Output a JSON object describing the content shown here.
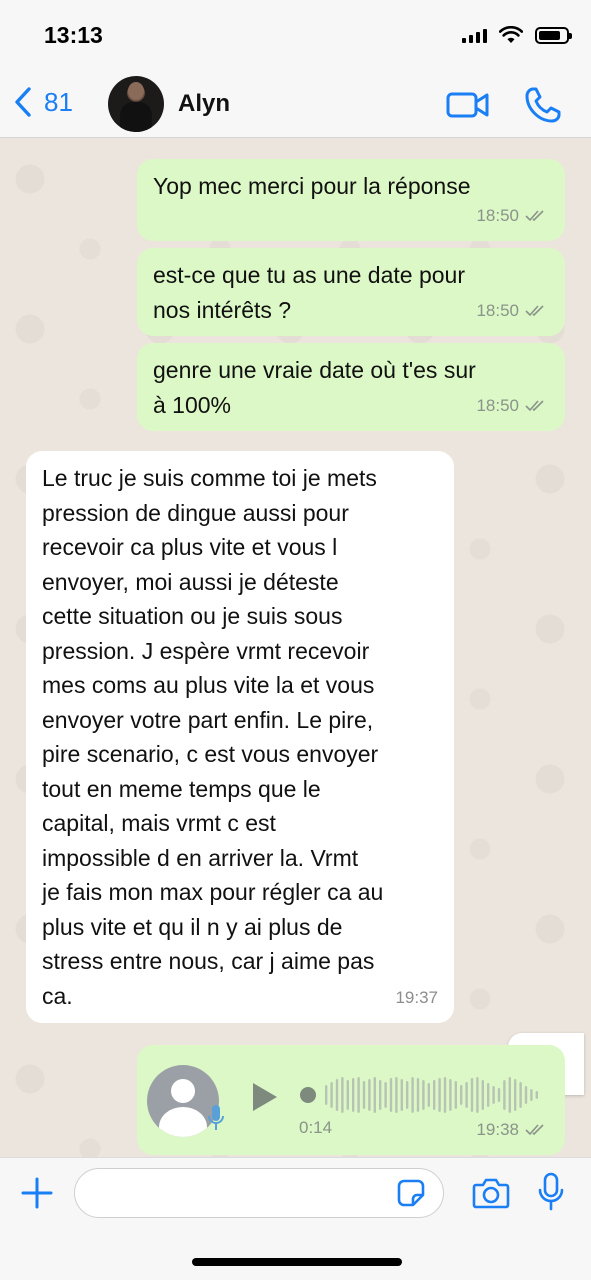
{
  "status_bar": {
    "time": "13:13",
    "icons": [
      "signal-icon",
      "wifi-icon",
      "battery-icon"
    ]
  },
  "header": {
    "back_count": "81",
    "contact_name": "Alyn",
    "icons": [
      "chevron-left-icon",
      "video-call-icon",
      "phone-icon"
    ]
  },
  "messages": [
    {
      "direction": "out",
      "text": "Yop mec merci pour la réponse",
      "time": "18:50",
      "read": true
    },
    {
      "direction": "out",
      "text": "est-ce que tu as une date pour\nnos intérêts ?",
      "time": "18:50",
      "read": true
    },
    {
      "direction": "out",
      "text": "genre une vraie date où t'es sur\nà 100%",
      "time": "18:50",
      "read": true
    },
    {
      "direction": "in",
      "text": "Le truc je suis comme toi je mets\npression de dingue aussi pour\nrecevoir ca plus vite et vous l\nenvoyer, moi aussi je déteste\ncette situation ou je suis sous\npression. J espère vrmt recevoir\nmes coms au plus vite la et vous\nenvoyer votre part enfin. Le pire,\npire scenario, c est vous envoyer\ntout en meme temps que le\ncapital, mais vrmt c est\nimpossible d en arriver la. Vrmt\nje fais mon max pour régler ca au\nplus vite et qu il n y ai plus de\nstress entre nous, car j aime pas\nca.",
      "time": "19:37"
    }
  ],
  "voice_message": {
    "direction": "out",
    "duration": "0:14",
    "time": "19:38",
    "read": true,
    "progress": 0
  },
  "input": {
    "value": "",
    "placeholder": ""
  },
  "colors": {
    "accent": "#1a7ff5",
    "outgoing_bubble": "#dcf8c6",
    "incoming_bubble": "#ffffff",
    "chat_background": "#ece5dd"
  }
}
